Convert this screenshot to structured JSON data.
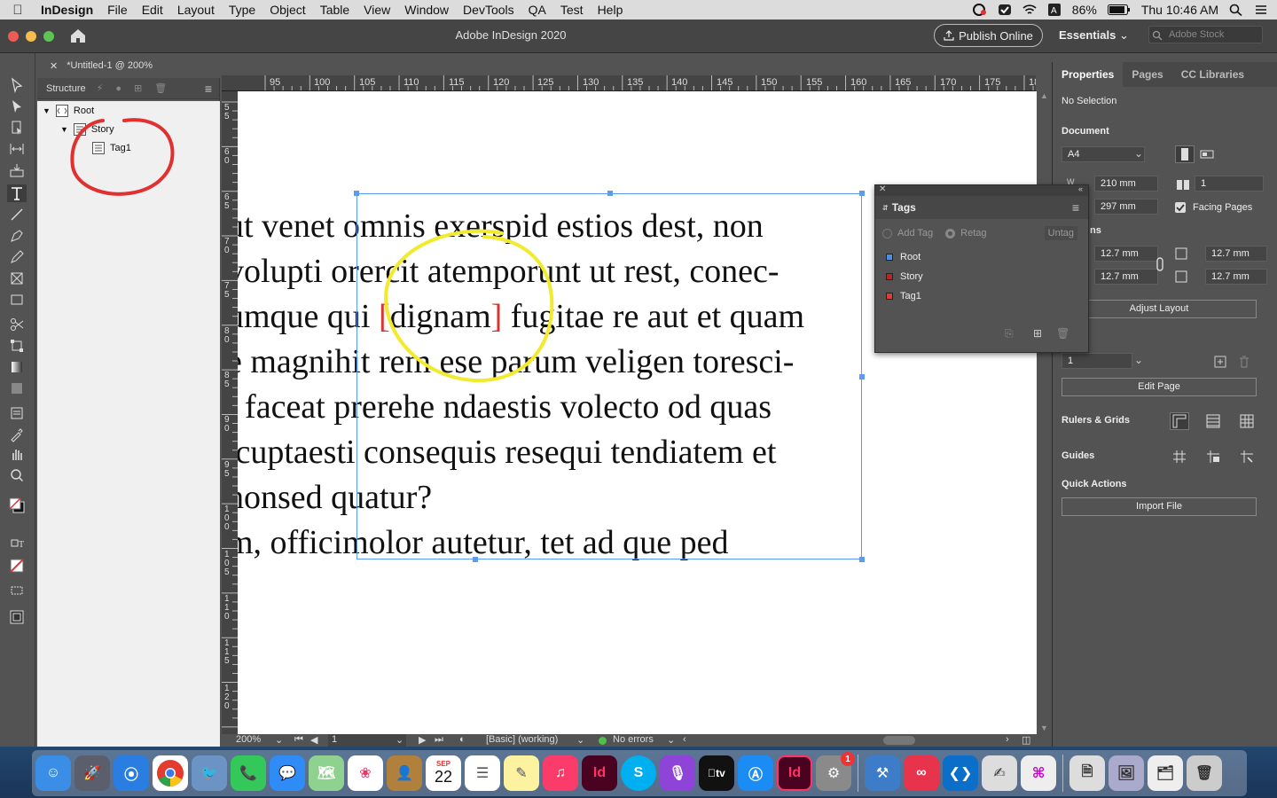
{
  "menubar": {
    "app": "InDesign",
    "items": [
      "File",
      "Edit",
      "Layout",
      "Type",
      "Object",
      "Table",
      "View",
      "Window",
      "DevTools",
      "QA",
      "Test",
      "Help"
    ],
    "battery": "86%",
    "clock": "Thu 10:46 AM"
  },
  "titlebar": {
    "title": "Adobe InDesign 2020",
    "publish": "Publish Online",
    "workspace": "Essentials",
    "search_placeholder": "Adobe Stock"
  },
  "document_tab": "*Untitled-1 @ 200%",
  "structure": {
    "title": "Structure",
    "nodes": [
      {
        "label": "Root",
        "level": 0
      },
      {
        "label": "Story",
        "level": 1
      },
      {
        "label": "Tag1",
        "level": 2
      }
    ]
  },
  "ruler": {
    "top": [
      "95",
      "100",
      "105",
      "110",
      "115",
      "120",
      "125",
      "130",
      "135",
      "140",
      "145",
      "150",
      "155",
      "160",
      "165",
      "170",
      "175",
      "18"
    ],
    "left": [
      "55",
      "60",
      "65",
      "70",
      "75",
      "80",
      "85",
      "90",
      "95",
      "100",
      "105",
      "110",
      "115",
      "120"
    ]
  },
  "text": {
    "lines": [
      "ut venet omnis exerspid estios dest, non",
      "volupti orercit atemporunt ut rest, conec-",
      "umque qui ",
      "e magnihit rem ese parum veligen toresci-",
      "t faceat prerehe ndaestis volecto od quas",
      " cuptaesti consequis resequi tendiatem et",
      "honsed quatur?",
      "m, officimolor autetur, tet ad que ped"
    ],
    "tagged_word": "dignam",
    "line3_tail": " fugitae re aut et quam",
    "bracket_open": "[",
    "bracket_close": "]"
  },
  "tags_panel": {
    "title": "Tags",
    "add_tag": "Add Tag",
    "retag": "Retag",
    "untag": "Untag",
    "tags": [
      {
        "name": "Root",
        "color": "#4a90e2"
      },
      {
        "name": "Story",
        "color": "#b02a2a"
      },
      {
        "name": "Tag1",
        "color": "#e03a3a"
      }
    ]
  },
  "properties": {
    "tabs": [
      "Properties",
      "Pages",
      "CC Libraries"
    ],
    "selection": "No Selection",
    "document_label": "Document",
    "page_size": "A4",
    "width": "210 mm",
    "height": "297 mm",
    "pages": "1",
    "facing_pages": "Facing Pages",
    "margins_label": "ns",
    "margin_top": "12.7 mm",
    "margin_bottom": "12.7 mm",
    "margin_left": "12.7 mm",
    "margin_right": "12.7 mm",
    "adjust_layout": "Adjust Layout",
    "page_select": "1",
    "edit_page": "Edit Page",
    "rulers_grids": "Rulers & Grids",
    "guides": "Guides",
    "quick_actions": "Quick Actions",
    "import_file": "Import File"
  },
  "status": {
    "zoom": "200%",
    "page": "1",
    "preflight_profile": "[Basic] (working)",
    "errors": "No errors"
  },
  "dock": {
    "calendar_month": "SEP",
    "calendar_day": "22",
    "indesign_label": "Id",
    "skype_label": "S",
    "badge": "1"
  },
  "colors": {
    "annotation_red": "#e03030",
    "annotation_yellow": "#f2ea2c",
    "frame_blue": "#5b9bf0"
  }
}
